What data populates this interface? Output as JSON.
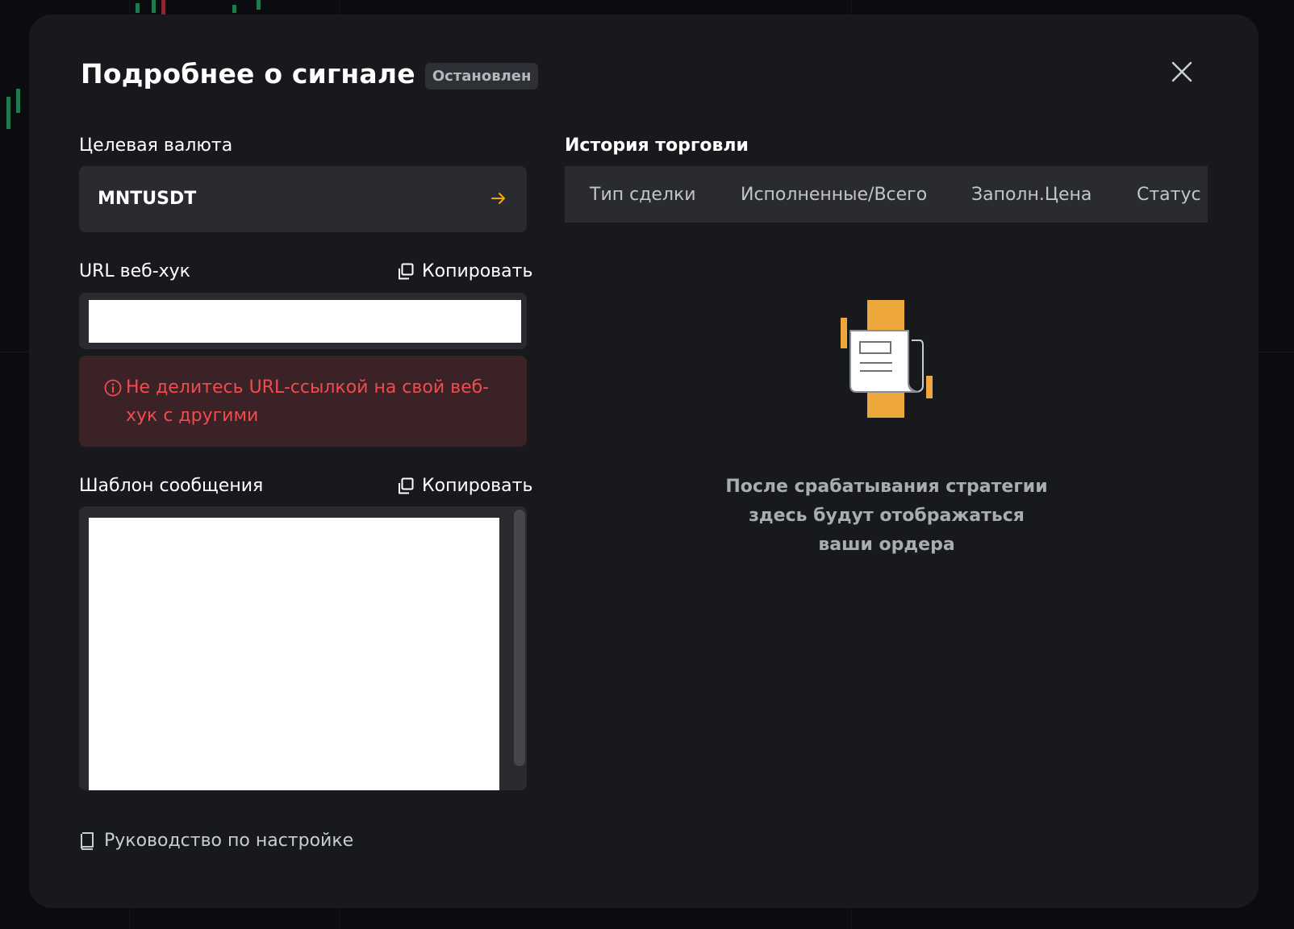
{
  "modal": {
    "title": "Подробнее о сигнале",
    "status_badge": "Остановлен",
    "close_icon": "close-icon"
  },
  "target_currency": {
    "label": "Целевая валюта",
    "value": "MNTUSDT",
    "icon": "arrow-right-icon",
    "accent_color": "#f7a600"
  },
  "webhook": {
    "label": "URL веб-хук",
    "copy_label": "Копировать",
    "copy_icon": "copy-icon",
    "value": "",
    "warning_icon": "info-icon",
    "warning_text": "Не делитесь URL-ссылкой на свой веб-хук с другими",
    "warning_color": "#ef4c4f"
  },
  "message_template": {
    "label": "Шаблон сообщения",
    "copy_label": "Копировать",
    "copy_icon": "copy-icon",
    "value": ""
  },
  "guide": {
    "label": "Руководство по настройке",
    "icon": "book-icon"
  },
  "trade_history": {
    "title": "История торговли",
    "columns": [
      "Тип сделки",
      "Исполненные/Всего",
      "Заполн.Цена",
      "Статус"
    ],
    "rows": [],
    "empty_text": "После срабатывания стратегии здесь будут отображаться ваши ордера",
    "empty_icon": "empty-orders-illustration"
  }
}
